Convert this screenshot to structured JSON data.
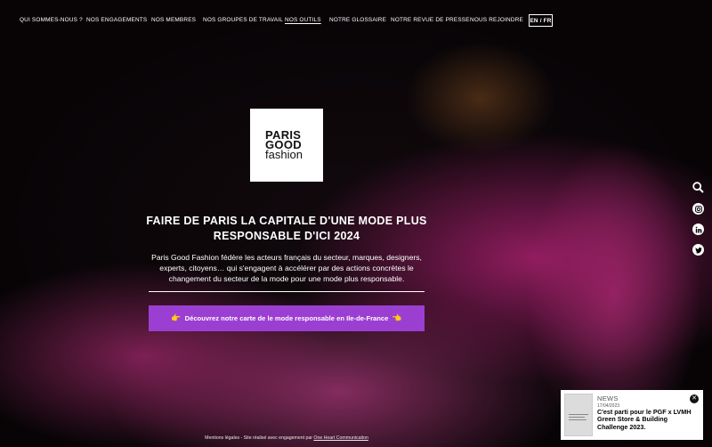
{
  "nav": {
    "items": [
      {
        "label": "QUI SOMMES-NOUS ?",
        "active": false
      },
      {
        "label": "NOS ENGAGEMENTS",
        "active": false
      },
      {
        "label": "NOS MEMBRES",
        "active": false
      },
      {
        "label": "NOS GROUPES DE TRAVAIL",
        "active": false
      },
      {
        "label": "NOS OUTILS",
        "active": true
      },
      {
        "label": "NOTRE GLOSSAIRE",
        "active": false
      },
      {
        "label": "NOTRE REVUE DE PRESSE",
        "active": false
      },
      {
        "label": "NOUS REJOINDRE",
        "active": false
      }
    ],
    "lang": "EN / FR"
  },
  "logo": {
    "line1": "PARIS",
    "line2": "GOOD",
    "line3": "fashion"
  },
  "hero": {
    "headline": "FAIRE DE PARIS LA CAPITALE D'UNE MODE PLUS RESPONSABLE D'ICI 2024",
    "description": "Paris Good Fashion fédère les acteurs français du secteur, marques, designers, experts, citoyens… qui s'engagent à accélérer par des actions concrètes le changement du secteur de la mode pour une mode plus responsable.",
    "cta": "Découvrez notre carte de le mode responsable en Ile-de-France",
    "cta_icon_left": "👉",
    "cta_icon_right": "👈"
  },
  "side_icons": [
    "search-icon",
    "instagram-icon",
    "linkedin-icon",
    "twitter-icon"
  ],
  "news": {
    "label": "NEWS",
    "date": "17/04/2023",
    "title": "C'est parti pour le PGF x LVMH Green Store & Building Challenge 2023.",
    "close": "✕"
  },
  "footer": {
    "text": "Mentions légales - Site réalisé avec engagement par",
    "link": "One Heart Communication"
  },
  "colors": {
    "cta": "#9b3fd2",
    "accent_pink": "#cd2887"
  }
}
